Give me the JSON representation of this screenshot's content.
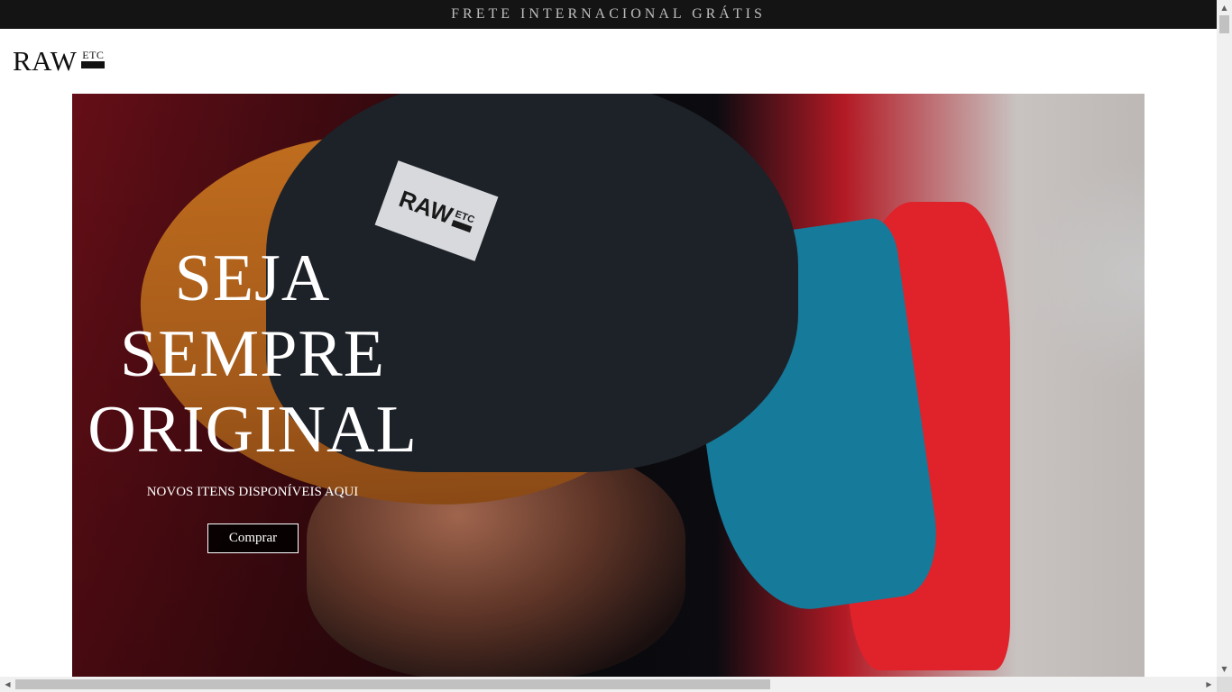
{
  "announcement": {
    "text": "FRETE INTERNACIONAL GRÁTIS"
  },
  "brand": {
    "name": "RAW",
    "suffix": "ETC"
  },
  "hero": {
    "headline_line1": "SEJA",
    "headline_line2": "SEMPRE",
    "headline_line3": "ORIGINAL",
    "subtitle": "NOVOS ITENS DISPONÍVEIS AQUI",
    "cta_label": "Comprar",
    "cap_label_main": "RAW",
    "cap_label_suffix": "ETC"
  },
  "colors": {
    "announcement_bg": "#141414",
    "announcement_text": "#bdbdbd",
    "hero_text": "#ffffff"
  },
  "icons": {
    "scroll_up": "▲",
    "scroll_down": "▼",
    "scroll_left": "◀",
    "scroll_right": "▶"
  }
}
